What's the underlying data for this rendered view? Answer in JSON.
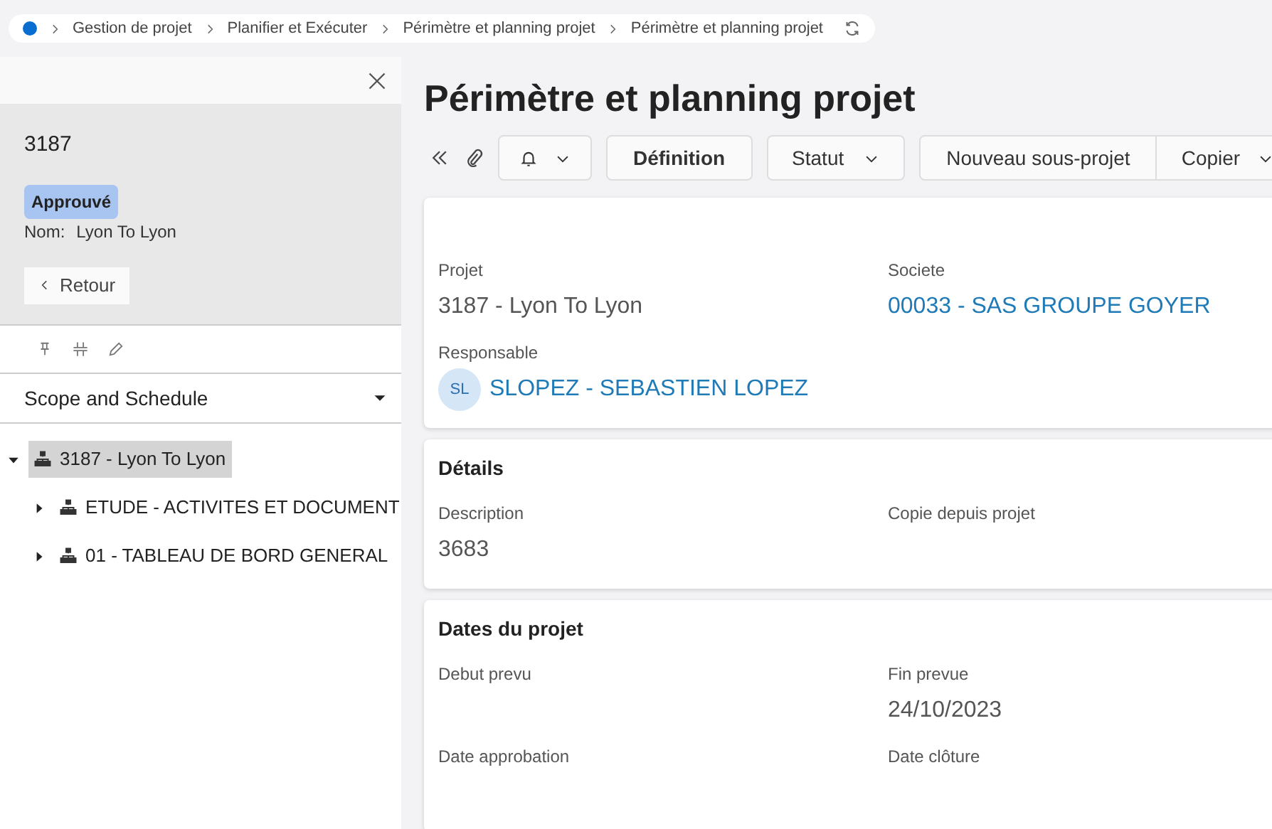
{
  "breadcrumb": {
    "items": [
      "Gestion de projet",
      "Planifier et Exécuter",
      "Périmètre et planning projet",
      "Périmètre et planning projet"
    ]
  },
  "side_panel": {
    "record_id": "3187",
    "status": "Approuvé",
    "name_label": "Nom:",
    "name_value": "Lyon To Lyon",
    "back_button": "Retour",
    "view_selector": "Scope and Schedule",
    "tree": [
      {
        "label": "3187 - Lyon To Lyon",
        "selected": true,
        "expanded": true,
        "children": [
          {
            "label": "ETUDE - ACTIVITES ET DOCUMENT",
            "selected": false,
            "expanded": false
          },
          {
            "label": "01 - TABLEAU DE BORD GENERAL",
            "selected": false,
            "expanded": false
          }
        ]
      }
    ]
  },
  "page_title": "Périmètre et planning projet",
  "toolbar": [
    {
      "kind": "icon-dropdown"
    },
    {
      "kind": "primary",
      "label": "Définition"
    },
    {
      "kind": "dropdown",
      "label": "Statut"
    },
    {
      "kind": "group",
      "labels": [
        "Nouveau sous-projet",
        "Copier"
      ]
    }
  ],
  "cards": [
    {
      "fields": [
        {
          "label": "Projet",
          "value": "3187 - Lyon To Lyon",
          "kind": "text"
        },
        {
          "label": "Societe",
          "value": "00033 - SAS GROUPE GOYER",
          "kind": "link"
        },
        {
          "label": "Responsable",
          "value": "SLOPEZ - SEBASTIEN LOPEZ",
          "initials": "SL",
          "kind": "person"
        }
      ]
    },
    {
      "title": "Détails",
      "fields": [
        {
          "label": "Description",
          "value": "3683",
          "kind": "text"
        },
        {
          "label": "Copie depuis projet",
          "kind": "text"
        }
      ]
    },
    {
      "title": "Dates du projet",
      "fields": [
        {
          "label": "Debut prevu",
          "kind": "text"
        },
        {
          "label": "Fin prevue",
          "value": "24/10/2023",
          "kind": "text"
        },
        {
          "label": "Date approbation",
          "kind": "text"
        },
        {
          "label": "Date clôture",
          "kind": "text"
        }
      ]
    }
  ]
}
